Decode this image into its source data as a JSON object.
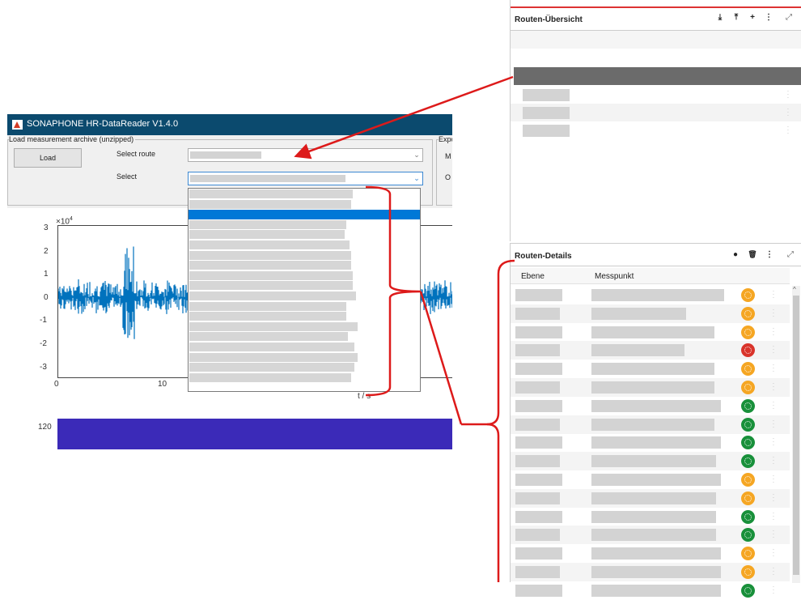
{
  "app": {
    "title": "SONAPHONE HR-DataReader V1.4.0",
    "load_section_label": "Load measurement archive (unzipped)",
    "load_button": "Load",
    "select_route_label": "Select route",
    "select_label": "Select",
    "export_label_partial": "Expo",
    "export_m_partial": "M",
    "export_o_partial": "O",
    "y_exponent": "×10",
    "y_exponent_power": "4",
    "y_ticks": [
      "3",
      "2",
      "1",
      "0",
      "-1",
      "-2",
      "-3"
    ],
    "x_ticks": [
      "0",
      "10"
    ],
    "x_label": "t / s",
    "lower_plot_tick": "120",
    "chevron_down_icon": "chevron-down-icon"
  },
  "overview": {
    "title": "Routen-Übersicht",
    "tools": [
      "⤓",
      "⤒",
      "+",
      "⋮",
      "⤢"
    ]
  },
  "details": {
    "title": "Routen-Details",
    "tools": [
      "●",
      "🗑",
      "⋮",
      "⤢"
    ],
    "col_ebene": "Ebene",
    "col_messpunkt": "Messpunkt",
    "row_status": [
      "orange",
      "orange",
      "orange",
      "red",
      "orange",
      "orange",
      "green",
      "green",
      "green",
      "green",
      "orange",
      "orange",
      "green",
      "green",
      "orange",
      "orange",
      "green"
    ]
  },
  "colors": {
    "accent_red": "#dd1a1a",
    "signal_blue": "#0072bd",
    "titlebar": "#0b4a6e",
    "status_orange": "#f5a623",
    "status_red": "#d9342b",
    "status_green": "#18903a",
    "selected_dark": "#6b6b6b",
    "dropdown_highlight": "#0078d7"
  }
}
